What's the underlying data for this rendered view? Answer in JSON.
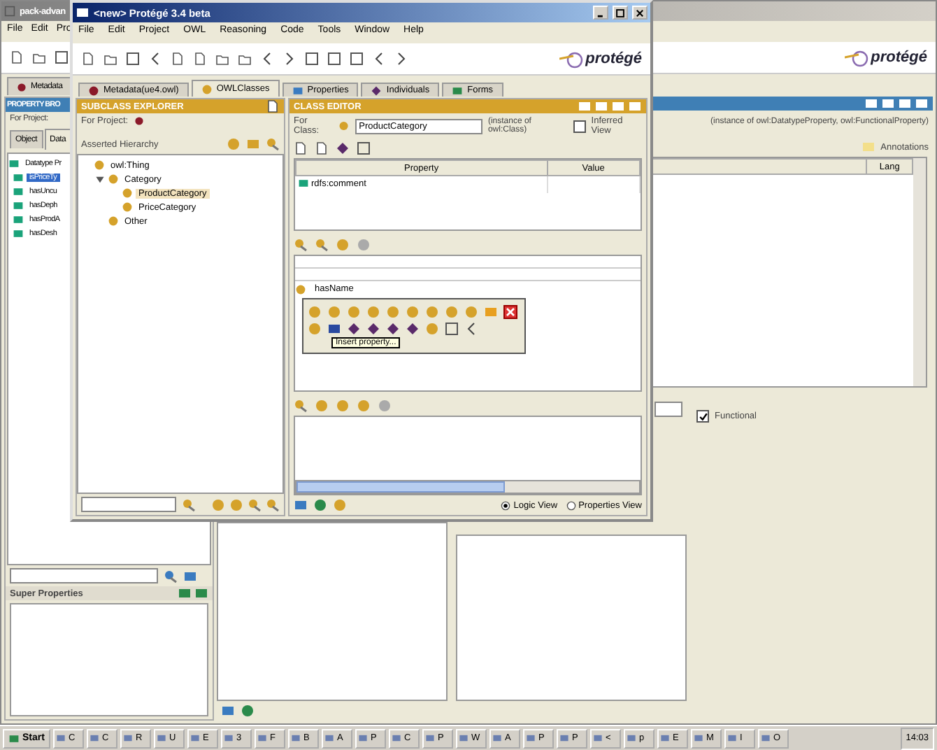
{
  "back_window": {
    "title": "pack-advan",
    "menu": [
      "File",
      "Edit",
      "Pro"
    ],
    "tab": "Metadata",
    "logo": "protégé",
    "panel_title": "PROPERTY BRO",
    "for_project": "For Project:",
    "subtabs": [
      {
        "label": "Object",
        "selected": false
      },
      {
        "label": "Data",
        "selected": true
      }
    ],
    "tree": [
      {
        "label": "Datatype Pr",
        "selected": false,
        "children": [
          {
            "label": "isPriceTy",
            "selected": true
          },
          {
            "label": "hasUncu",
            "selected": false
          },
          {
            "label": "hasDeph",
            "selected": false
          },
          {
            "label": "hasProdA",
            "selected": false
          },
          {
            "label": "hasDesh",
            "selected": false
          }
        ]
      }
    ],
    "instance_of": "(instance of owl:DatatypeProperty, owl:FunctionalProperty)",
    "annotations": "Annotations",
    "table_columns": [
      "Lang"
    ],
    "functional": {
      "label": "Functional",
      "checked": true
    },
    "super_properties": "Super Properties"
  },
  "window": {
    "title": "<new>  Protégé 3.4 beta",
    "menu": [
      "File",
      "Edit",
      "Project",
      "OWL",
      "Reasoning",
      "Code",
      "Tools",
      "Window",
      "Help"
    ],
    "logo": "protégé",
    "tabs": [
      {
        "label": "Metadata(ue4.owl)",
        "kind": "metadata",
        "selected": false
      },
      {
        "label": "OWLClasses",
        "kind": "classes",
        "selected": true
      },
      {
        "label": "Properties",
        "kind": "properties",
        "selected": false
      },
      {
        "label": "Individuals",
        "kind": "individuals",
        "selected": false
      },
      {
        "label": "Forms",
        "kind": "forms",
        "selected": false
      }
    ],
    "explorer": {
      "title": "SUBCLASS EXPLORER",
      "for_project": "For Project:",
      "hierarchy_label": "Asserted Hierarchy",
      "tree": [
        {
          "label": "owl:Thing",
          "selected": false,
          "children": [
            {
              "label": "Category",
              "selected": false,
              "expanded": true,
              "children": [
                {
                  "label": "ProductCategory",
                  "selected": true
                },
                {
                  "label": "PriceCategory",
                  "selected": false
                }
              ]
            },
            {
              "label": "Other",
              "selected": false
            }
          ]
        }
      ]
    },
    "editor": {
      "title": "CLASS EDITOR",
      "for_class": "For Class:",
      "class_name": "ProductCategory",
      "instance_of": "(instance of owl:Class)",
      "inferred_view": {
        "label": "Inferred View",
        "checked": false
      },
      "columns": [
        "Property",
        "Value"
      ],
      "rows": [
        {
          "property": "rdfs:comment"
        }
      ],
      "condition_input": "hasName",
      "tooltip": "Insert property...",
      "views": [
        {
          "label": "Logic View",
          "selected": true
        },
        {
          "label": "Properties View",
          "selected": false
        }
      ]
    }
  },
  "taskbar": {
    "start": "Start",
    "buttons": [
      "C",
      "C",
      "R",
      "U",
      "E",
      "3",
      "F",
      "B",
      "A",
      "P",
      "C",
      "P",
      "W",
      "A",
      "P",
      "P",
      "<",
      "p",
      "E",
      "M",
      "I",
      "O"
    ],
    "clock": "14:03"
  }
}
